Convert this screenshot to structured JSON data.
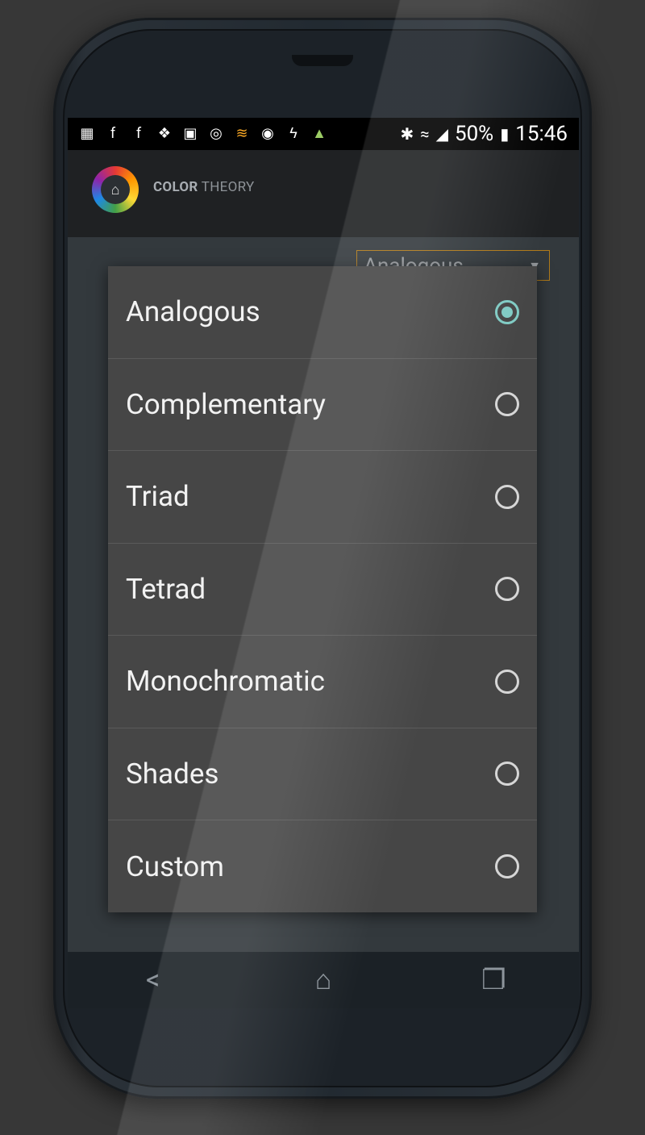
{
  "status_bar": {
    "left_icons": [
      "calendar-icon",
      "facebook-icon",
      "facebook-icon",
      "dropbox-icon",
      "gallery-icon",
      "instagram-icon",
      "wifi-signal-app-icon",
      "sync-icon",
      "lightning-icon",
      "android-icon"
    ],
    "right_icons": [
      "bluetooth-icon",
      "wifi-icon",
      "cell-signal-icon"
    ],
    "battery": "50%",
    "time": "15:46"
  },
  "app_bar": {
    "title_bold": "COLOR",
    "title_rest": " THEORY",
    "logo_icon": "home-icon"
  },
  "spinner": {
    "selected": "Analogous"
  },
  "dialog": {
    "options": [
      {
        "label": "Analogous",
        "checked": true
      },
      {
        "label": "Complementary",
        "checked": false
      },
      {
        "label": "Triad",
        "checked": false
      },
      {
        "label": "Tetrad",
        "checked": false
      },
      {
        "label": "Monochromatic",
        "checked": false
      },
      {
        "label": "Shades",
        "checked": false
      },
      {
        "label": "Custom",
        "checked": false
      }
    ],
    "accent_color": "#80cbc4"
  },
  "nav_bar": {
    "back_icon": "back-icon",
    "home_icon": "home-icon",
    "recents_icon": "recents-icon"
  }
}
